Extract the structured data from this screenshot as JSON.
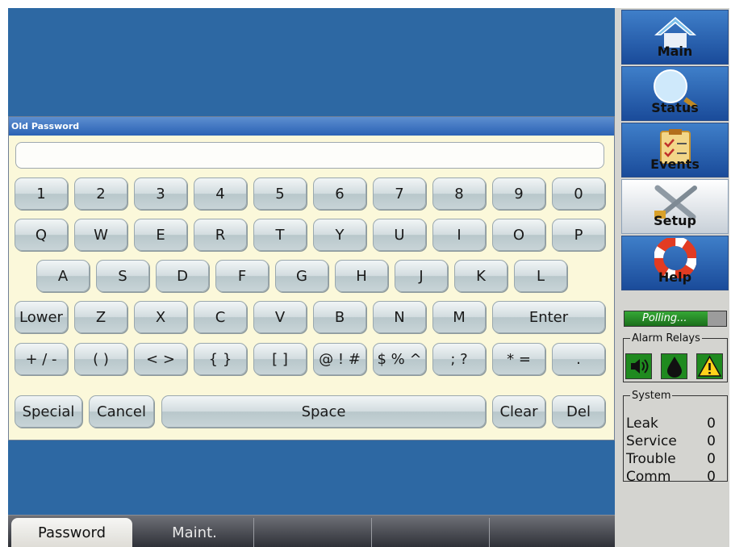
{
  "dialog": {
    "title": "Old Password",
    "input_value": ""
  },
  "keyboard": {
    "row1": [
      "1",
      "2",
      "3",
      "4",
      "5",
      "6",
      "7",
      "8",
      "9",
      "0"
    ],
    "row2": [
      "Q",
      "W",
      "E",
      "R",
      "T",
      "Y",
      "U",
      "I",
      "O",
      "P"
    ],
    "row3": [
      "A",
      "S",
      "D",
      "F",
      "G",
      "H",
      "J",
      "K",
      "L"
    ],
    "row4": [
      "Lower",
      "Z",
      "X",
      "C",
      "V",
      "B",
      "N",
      "M",
      "Enter"
    ],
    "row5": [
      "+ / -",
      "( )",
      "< >",
      "{ }",
      "[ ]",
      "@ ! #",
      "$ % ^",
      "; ?",
      "* =",
      "."
    ],
    "row6": [
      "Special",
      "Cancel",
      "Space",
      "Clear",
      "Del"
    ]
  },
  "nav": [
    {
      "label": "Main",
      "icon": "home-icon"
    },
    {
      "label": "Status",
      "icon": "magnifier-icon"
    },
    {
      "label": "Events",
      "icon": "clipboard-icon"
    },
    {
      "label": "Setup",
      "icon": "tools-icon",
      "active": true
    },
    {
      "label": "Help",
      "icon": "lifebuoy-icon"
    }
  ],
  "polling": {
    "label": "Polling...",
    "progress": 0.82
  },
  "alarm_relays": {
    "title": "Alarm Relays",
    "icons": [
      "speaker-icon",
      "drop-icon",
      "warning-icon"
    ]
  },
  "system": {
    "title": "System",
    "rows": [
      {
        "label": "Leak",
        "value": "0"
      },
      {
        "label": "Service",
        "value": "0"
      },
      {
        "label": "Trouble",
        "value": "0"
      },
      {
        "label": "Comm",
        "value": "0"
      }
    ]
  },
  "tabs": [
    {
      "label": "Password",
      "active": true
    },
    {
      "label": "Maint.",
      "active": false
    },
    {
      "label": "",
      "active": false
    },
    {
      "label": "",
      "active": false
    },
    {
      "label": "",
      "active": false
    }
  ],
  "colors": {
    "background": "#2d68a3",
    "dialog": "#fbf8da",
    "title_bar": "#2a62b4",
    "polling_green": "#1b6f1b"
  }
}
